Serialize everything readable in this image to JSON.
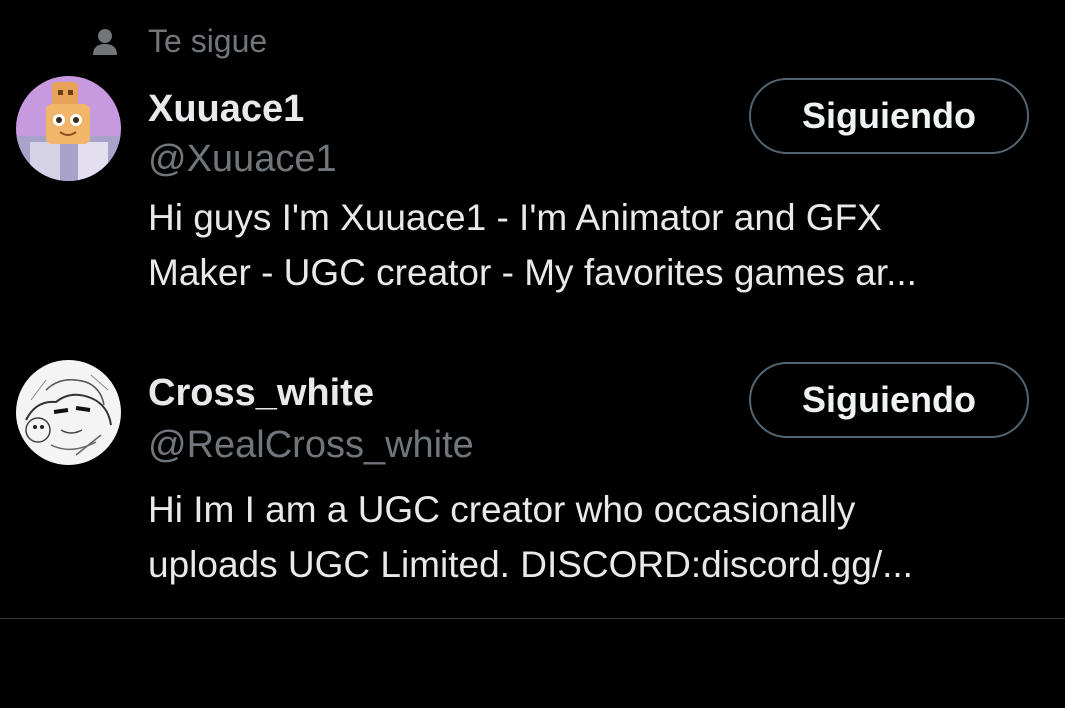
{
  "follows_you": {
    "label": "Te sigue",
    "icon": "person-icon"
  },
  "users": [
    {
      "display_name": "Xuuace1",
      "handle": "@Xuuace1",
      "bio_lines": [
        "Hi guys I'm Xuuace1 - I'm Animator and GFX",
        "Maker - UGC creator - My favorites games ar..."
      ],
      "button_label": "Siguiendo"
    },
    {
      "display_name": "Cross_white",
      "handle": "@RealCross_white",
      "bio_lines": [
        "Hi Im I am a UGC creator who occasionally",
        "uploads UGC Limited. DISCORD:discord.gg/..."
      ],
      "button_label": "Siguiendo"
    }
  ],
  "colors": {
    "background": "#000000",
    "primary_text": "#e7e9ea",
    "secondary_text": "#71767b",
    "button_border": "#536471",
    "divider": "#2f3336"
  }
}
